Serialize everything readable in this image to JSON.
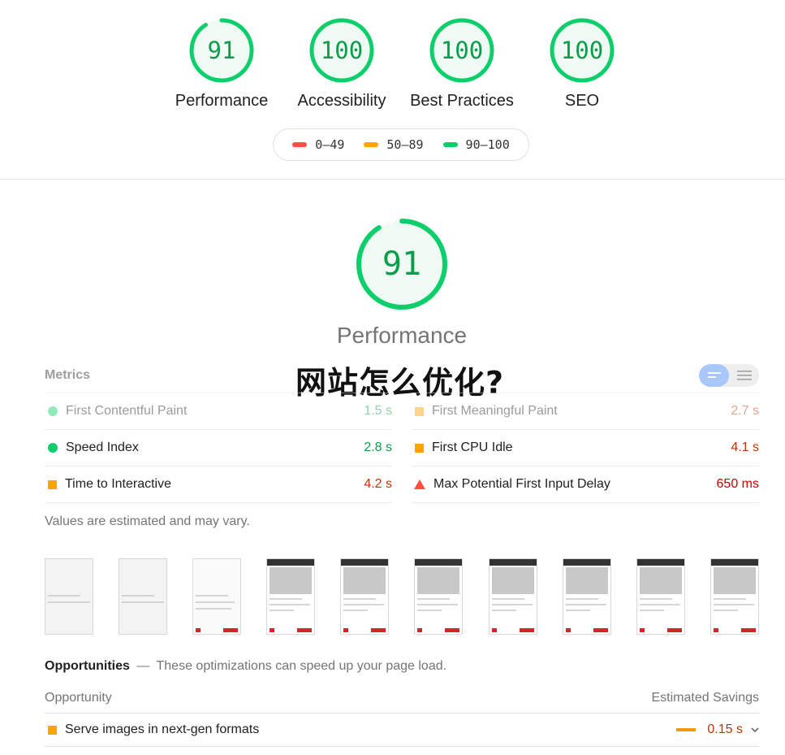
{
  "colors": {
    "pass": "#0cce6b",
    "average": "#ffa400",
    "fail": "#ff4e42",
    "pass_text": "#0c9d4a"
  },
  "gauges": [
    {
      "score": "91",
      "label": "Performance",
      "fraction": 0.91
    },
    {
      "score": "100",
      "label": "Accessibility",
      "fraction": 1.0
    },
    {
      "score": "100",
      "label": "Best Practices",
      "fraction": 1.0
    },
    {
      "score": "100",
      "label": "SEO",
      "fraction": 1.0
    }
  ],
  "legend": [
    {
      "range": "0–49"
    },
    {
      "range": "50–89"
    },
    {
      "range": "90–100"
    }
  ],
  "performance": {
    "score": "91",
    "title": "Performance",
    "fraction": 0.91
  },
  "overlay_title": "网站怎么优化?",
  "metrics": {
    "heading": "Metrics",
    "left": [
      {
        "name": "First Contentful Paint",
        "value": "1.5 s"
      },
      {
        "name": "Speed Index",
        "value": "2.8 s"
      },
      {
        "name": "Time to Interactive",
        "value": "4.2 s"
      }
    ],
    "right": [
      {
        "name": "First Meaningful Paint",
        "value": "2.7 s"
      },
      {
        "name": "First CPU Idle",
        "value": "4.1 s"
      },
      {
        "name": "Max Potential First Input Delay",
        "value": "650 ms"
      }
    ],
    "note": "Values are estimated and may vary."
  },
  "opportunities": {
    "title": "Opportunities",
    "dash": "—",
    "subtitle": "These optimizations can speed up your page load.",
    "col_left": "Opportunity",
    "col_right": "Estimated Savings",
    "rows": [
      {
        "name": "Serve images in next-gen formats",
        "savings": "0.15 s"
      }
    ]
  }
}
